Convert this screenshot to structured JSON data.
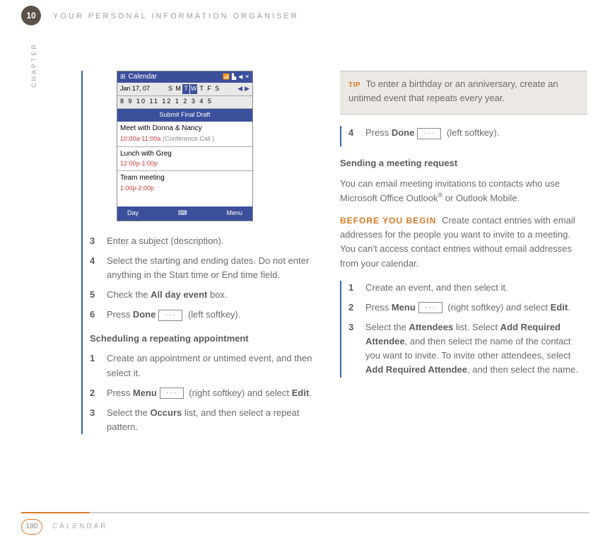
{
  "chapter": {
    "number": "10",
    "side": "CHAPTER",
    "title": "YOUR PERSONAL INFORMATION ORGANISER"
  },
  "footer": {
    "page": "180",
    "label": "CALENDAR"
  },
  "device": {
    "app": "Calendar",
    "date": "Jan 17, 07",
    "dow": [
      "S",
      "M",
      "T",
      "W",
      "T",
      "F",
      "S"
    ],
    "hours": "8   9   10   11   12   1   2   3   4   5",
    "banner": "Submit Final Draft",
    "rows": [
      {
        "title": "Meet with Donna & Nancy",
        "time": "10:00a-11:00a",
        "note": "(Conference Call )"
      },
      {
        "title": "Lunch with Greg",
        "time": "12:00p-1:00p",
        "note": ""
      },
      {
        "title": "Team meeting",
        "time": "1:00p-2:00p",
        "note": ""
      }
    ],
    "soft_left": "Day",
    "soft_right": "Menu"
  },
  "left": {
    "steps_a": [
      {
        "n": "3",
        "t": "Enter a subject (description)."
      },
      {
        "n": "4",
        "t": "Select the starting and ending dates. Do not enter anything in the Start time or End time field."
      },
      {
        "n": "5",
        "t_pre": "Check the ",
        "b1": "All day event",
        "t_post": " box."
      },
      {
        "n": "6",
        "t_pre": "Press ",
        "b1": "Done",
        "t_post": " (left softkey)."
      }
    ],
    "heading": "Scheduling a repeating appointment",
    "steps_b": [
      {
        "n": "1",
        "t": "Create an appointment or untimed event, and then select it."
      },
      {
        "n": "2",
        "t_pre": "Press ",
        "b1": "Menu",
        "t_mid": " (right softkey) and select ",
        "b2": "Edit",
        "t_post": "."
      },
      {
        "n": "3",
        "t_pre": "Select the ",
        "b1": "Occurs",
        "t_post": " list, and then select a repeat pattern."
      }
    ]
  },
  "right": {
    "tip_label": "TIP",
    "tip": "To enter a birthday or an anniversary, create an untimed event that repeats every year.",
    "step4": {
      "n": "4",
      "t_pre": "Press ",
      "b1": "Done",
      "t_post": " (left softkey)."
    },
    "heading": "Sending a meeting request",
    "intro": "You can email meeting invitations to contacts who use Microsoft Office Outlook",
    "intro2": " or Outlook Mobile.",
    "byb_label": "BEFORE YOU BEGIN",
    "byb": "Create contact entries with email addresses for the people you want to invite to a meeting. You can't access contact entries without email addresses from your calendar.",
    "steps": [
      {
        "n": "1",
        "t": "Create an event, and then select it."
      },
      {
        "n": "2",
        "t_pre": "Press ",
        "b1": "Menu",
        "t_mid": " (right softkey) and select ",
        "b2": "Edit",
        "t_post": "."
      },
      {
        "n": "3",
        "t_pre": "Select the ",
        "b1": "Attendees",
        "t_mid": " list. Select ",
        "b2": "Add Required Attendee",
        "t_mid2": ", and then select the name of the contact you want to invite. To invite other attendees, select ",
        "b3": "Add Required Attendee",
        "t_post": ", and then select the name."
      }
    ]
  }
}
